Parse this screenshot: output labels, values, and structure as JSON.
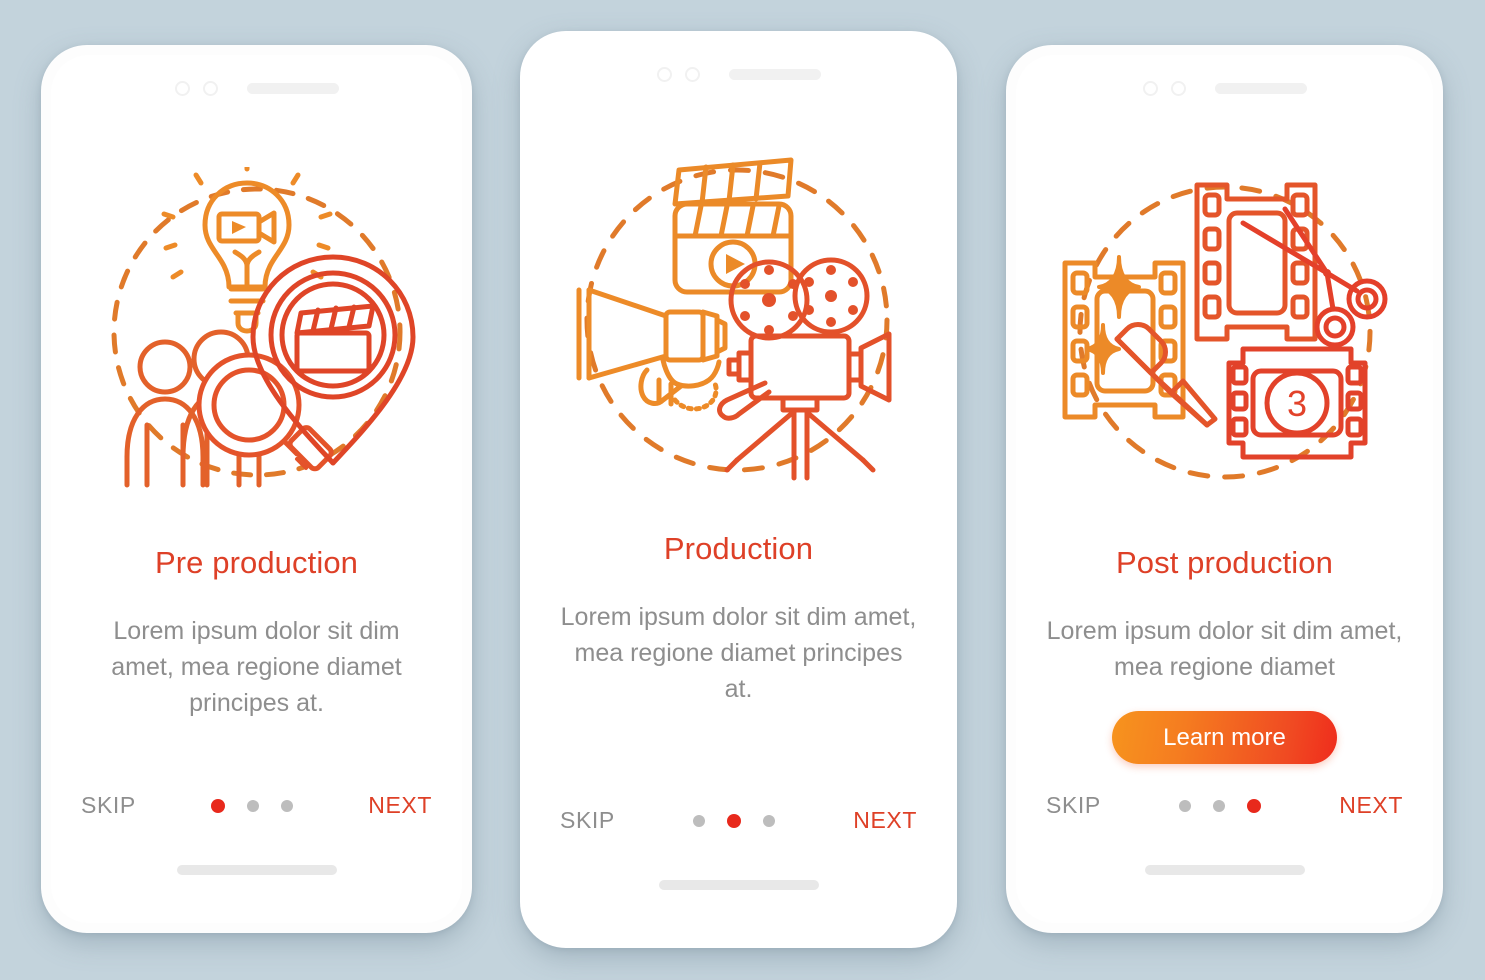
{
  "background_color": "#c3d3dc",
  "theme": {
    "title_color": "#de4027",
    "body_color": "#8e8e8e",
    "active_dot_color": "#e8291c",
    "inactive_dot_color": "#bdbdbd",
    "cta_gradient_from": "#f7941e",
    "cta_gradient_to": "#ef2c1c",
    "screen_background": "#ffffff"
  },
  "screens": [
    {
      "id": "pre-production",
      "title": "Pre production",
      "body": "Lorem ipsum dolor sit dim amet, mea regione diamet principes at.",
      "illustration_name": "pre-production-illustration",
      "illustration_parts": [
        "lightbulb-video-icon",
        "people-icon",
        "magnifier-icon",
        "location-pin-clapperboard-icon",
        "dashed-circle"
      ],
      "cta": null,
      "skip_label": "SKIP",
      "next_label": "NEXT",
      "dots": {
        "count": 3,
        "active_index": 0
      }
    },
    {
      "id": "production",
      "title": "Production",
      "body": "Lorem ipsum dolor sit dim amet, mea regione diamet principes at.",
      "illustration_name": "production-illustration",
      "illustration_parts": [
        "clapperboard-play-icon",
        "megaphone-hand-icon",
        "film-camera-tripod-icon",
        "dashed-circle"
      ],
      "cta": null,
      "skip_label": "SKIP",
      "next_label": "NEXT",
      "dots": {
        "count": 3,
        "active_index": 1
      }
    },
    {
      "id": "post-production",
      "title": "Post production",
      "body": "Lorem ipsum dolor sit dim amet, mea regione diamet",
      "illustration_name": "post-production-illustration",
      "illustration_parts": [
        "film-frame-sparkle-brush-icon",
        "film-frame-scissors-icon",
        "film-frame-countdown-3-icon",
        "dashed-circle"
      ],
      "cta": {
        "label": "Learn more"
      },
      "skip_label": "SKIP",
      "next_label": "NEXT",
      "dots": {
        "count": 3,
        "active_index": 2
      }
    }
  ],
  "hardware": {
    "sensor_left": "camera-sensor-dot",
    "sensor_right": "camera-sensor-dot",
    "speaker": "earpiece-speaker-bar",
    "home_indicator": "home-indicator-bar"
  }
}
